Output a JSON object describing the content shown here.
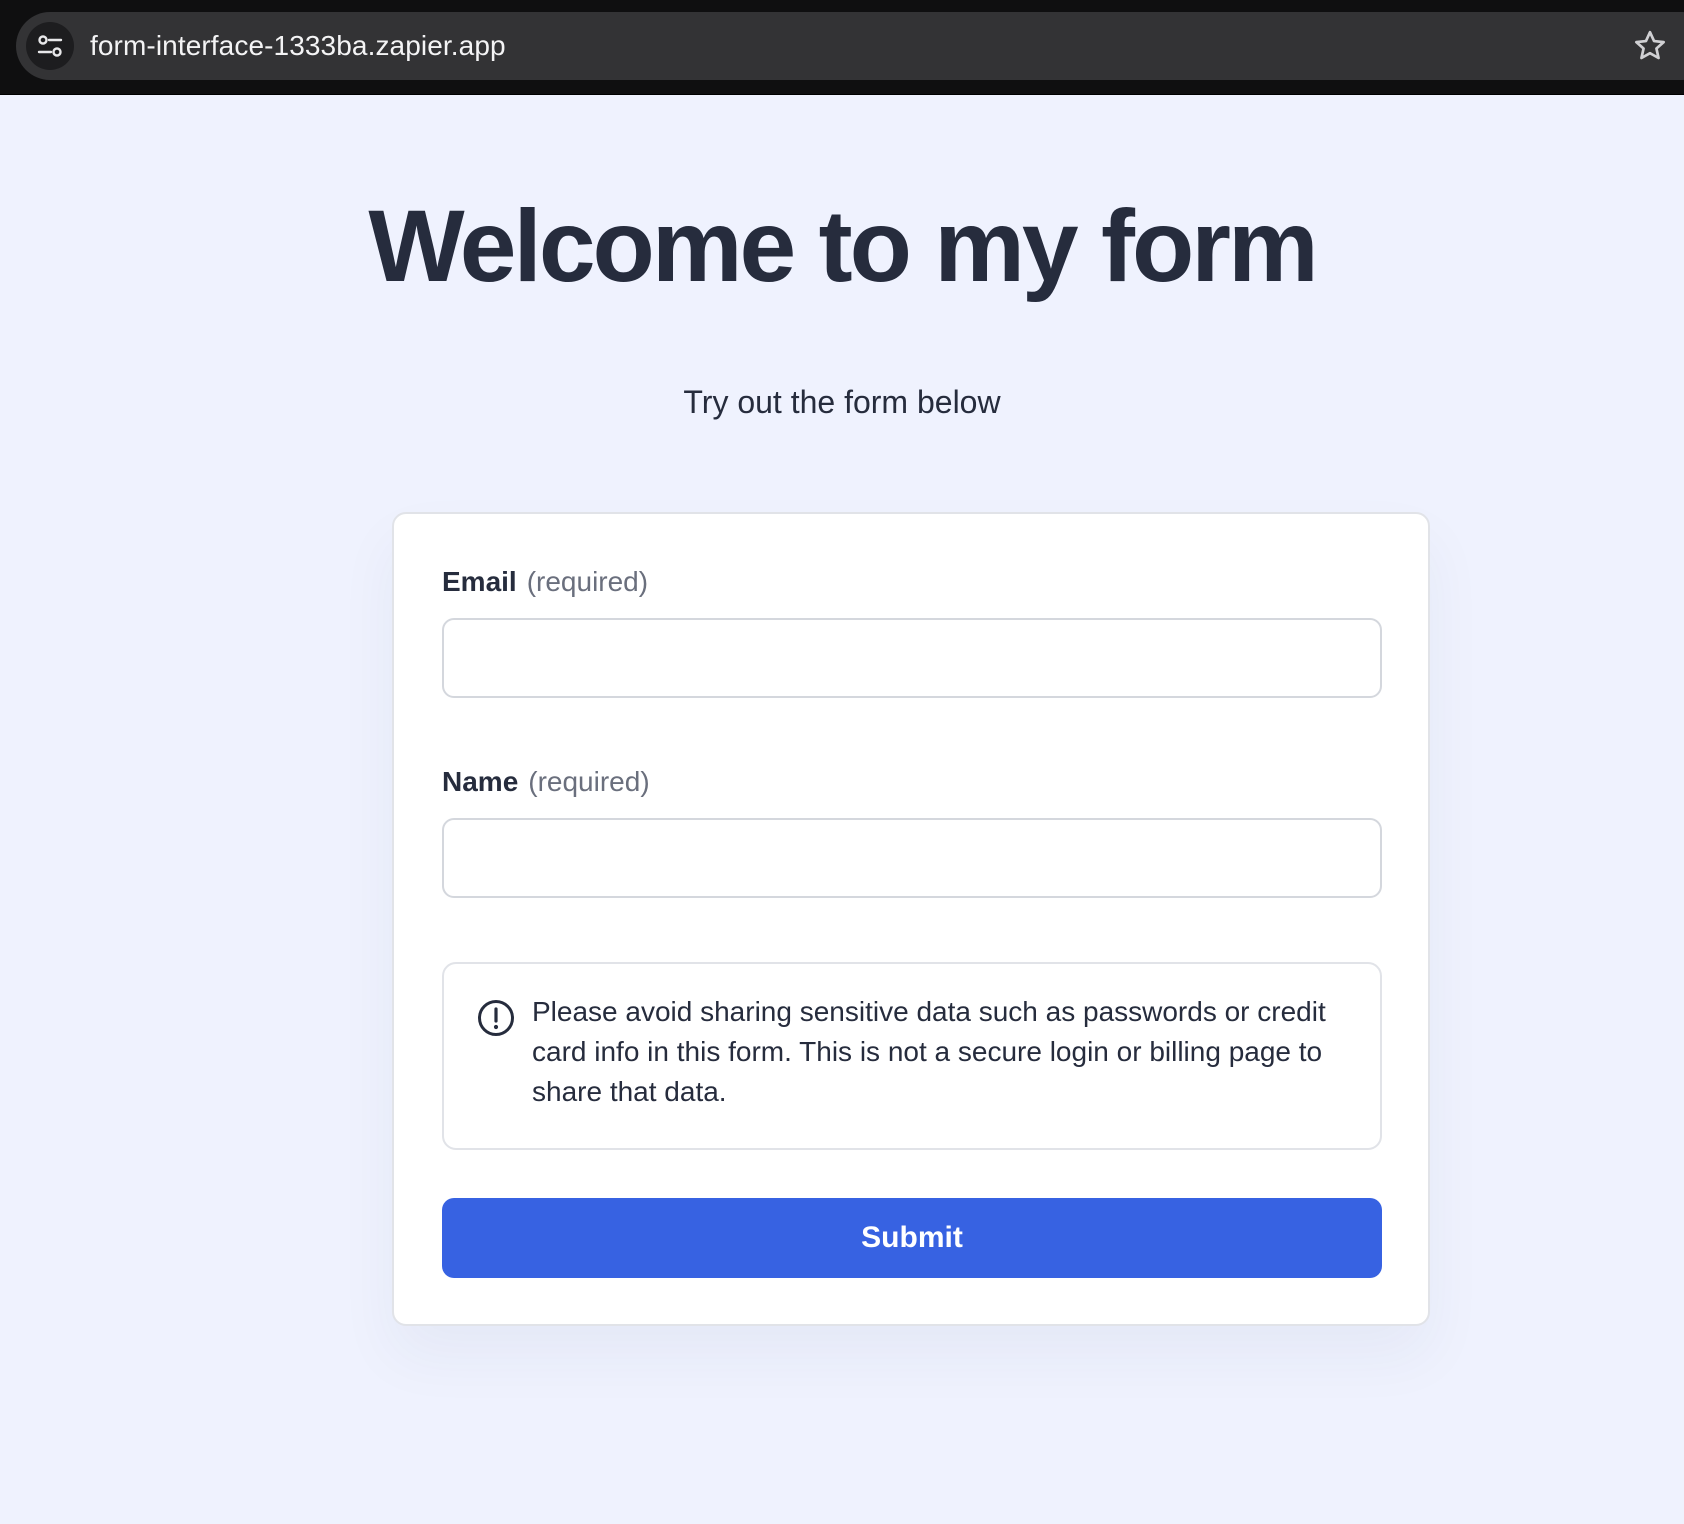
{
  "browser": {
    "url": "form-interface-1333ba.zapier.app",
    "site_controls_icon": "tune-icon",
    "bookmark_icon": "star-outline-icon"
  },
  "page": {
    "title": "Welcome to my form",
    "subtitle": "Try out the form below",
    "background_color": "#eff2fe"
  },
  "form": {
    "fields": [
      {
        "label": "Email",
        "qualifier": "(required)",
        "value": "",
        "placeholder": ""
      },
      {
        "label": "Name",
        "qualifier": "(required)",
        "value": "",
        "placeholder": ""
      }
    ],
    "notice": {
      "icon": "exclamation-circle-icon",
      "text": "Please avoid sharing sensitive data such as passwords or credit card info in this form. This is not a secure login or billing page to share that data."
    },
    "submit_label": "Submit",
    "accent_color": "#3762e2"
  }
}
